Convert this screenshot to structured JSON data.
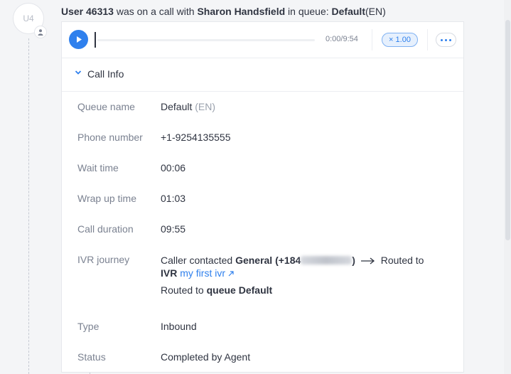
{
  "event": {
    "avatar_initials": "U4",
    "user": "User 46313",
    "text_mid": "was on a call with",
    "contact": "Sharon Handsfield",
    "text_queue": "in queue:",
    "queue_name": "Default",
    "queue_lang": "(EN)"
  },
  "player": {
    "time": "0:00/9:54",
    "speed": "× 1.00",
    "progress": 0
  },
  "call_info": {
    "title": "Call Info",
    "queue_name_label": "Queue name",
    "queue_name_value": "Default",
    "queue_name_lang": "(EN)",
    "phone_label": "Phone number",
    "phone_value": "+1-9254135555",
    "wait_label": "Wait time",
    "wait_value": "00:06",
    "wrap_label": "Wrap up time",
    "wrap_value": "01:03",
    "duration_label": "Call duration",
    "duration_value": "09:55",
    "ivr_label": "IVR journey",
    "ivr_caller": "Caller contacted",
    "ivr_number_name": "General (+184",
    "ivr_number_close": ")",
    "ivr_routed_to": "Routed to",
    "ivr_type": "IVR",
    "ivr_link": "my first ivr",
    "ivr_routed_to_2": "Routed to",
    "ivr_queue": "queue Default",
    "type_label": "Type",
    "type_value": "Inbound",
    "status_label": "Status",
    "status_value": "Completed by Agent"
  },
  "colors": {
    "accent": "#2f80ed",
    "label": "#7b8291",
    "text": "#2f3441"
  },
  "icons": [
    "person-icon",
    "play-icon",
    "more-icon",
    "chevron-down-icon",
    "arrow-right-icon",
    "external-link-icon"
  ]
}
